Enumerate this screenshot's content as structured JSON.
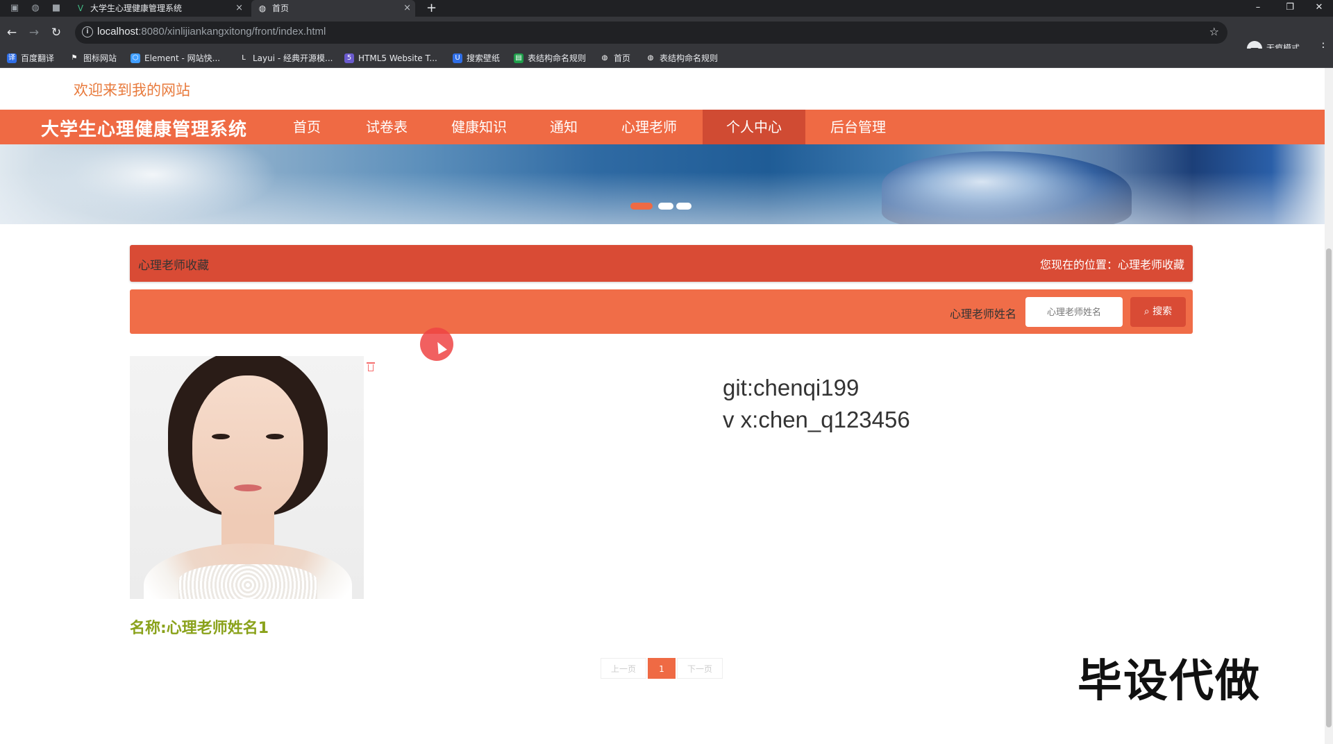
{
  "browser": {
    "tabs": [
      {
        "title": "大学生心理健康管理系统",
        "active": false
      },
      {
        "title": "首页",
        "active": true
      }
    ],
    "url_host": "localhost",
    "url_path": ":8080/xinlijiankangxitong/front/index.html",
    "incognito_label": "无痕模式",
    "bookmarks": [
      "百度翻译",
      "图标网站",
      "Element - 网站快...",
      "Layui - 经典开源模...",
      "HTML5 Website T...",
      "搜索壁纸",
      "表结构命名规则",
      "首页",
      "表结构命名规则"
    ]
  },
  "page": {
    "welcome": "欢迎来到我的网站",
    "brand": "大学生心理健康管理系统",
    "nav": [
      "首页",
      "试卷表",
      "健康知识",
      "通知",
      "心理老师",
      "个人中心",
      "后台管理"
    ],
    "nav_active_index": 5,
    "banner_slides": 3,
    "banner_active_slide": 0,
    "section_title": "心理老师收藏",
    "breadcrumb": "您现在的位置：心理老师收藏",
    "search": {
      "label": "心理老师姓名",
      "placeholder": "心理老师姓名",
      "button_label": "搜索"
    },
    "card": {
      "name": "名称:心理老师姓名1"
    },
    "contact_line1": "git:chenqi199",
    "contact_line2": "v x:chen_q123456",
    "pagination": {
      "prev": "上一页",
      "current": "1",
      "next": "下一页"
    },
    "watermark": "毕设代做"
  },
  "colors": {
    "primary": "#ef6a44",
    "primary_dark": "#d94b35",
    "welcome_text": "#e87a3c",
    "card_name": "#8aa21b"
  }
}
